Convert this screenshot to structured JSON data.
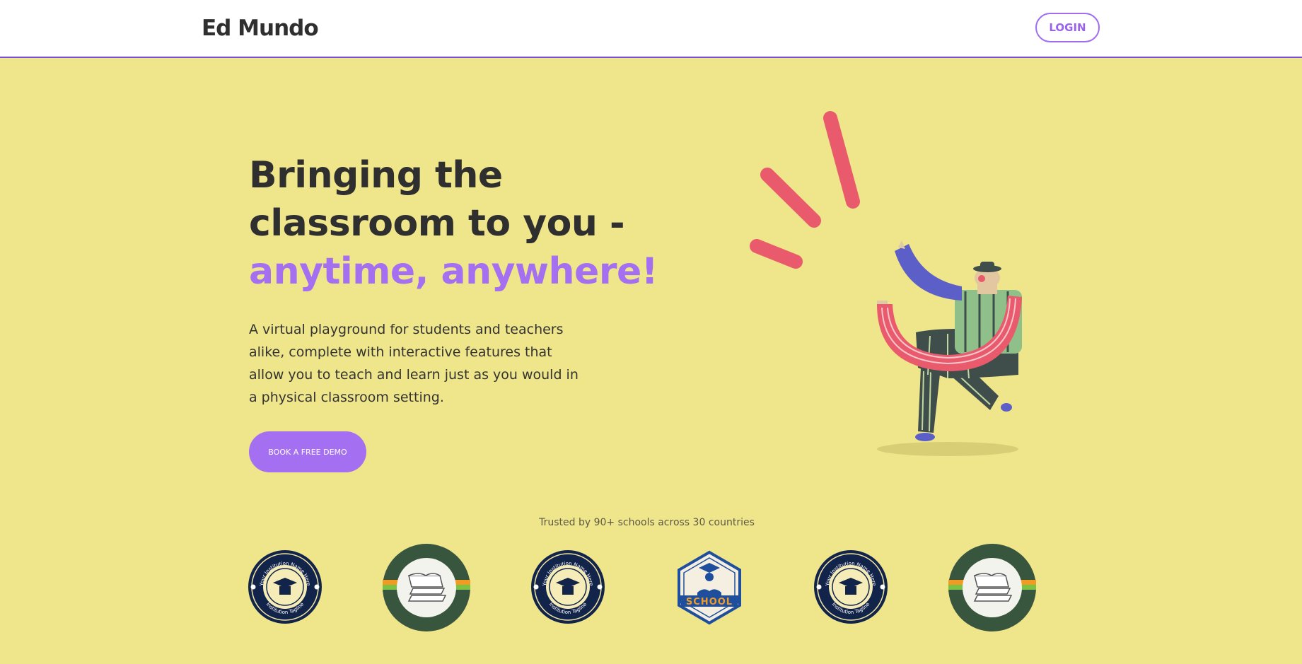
{
  "header": {
    "brand": "Ed Mundo",
    "login_label": "LOGIN"
  },
  "hero": {
    "title_line1": "Bringing the",
    "title_line2": "classroom to you -",
    "title_accent": "anytime, anywhere!",
    "subtitle": "A virtual playground for students and teachers alike, complete with interactive features that allow you to teach and learn just as you would in a physical classroom setting.",
    "cta_label": "BOOK A FREE DEMO"
  },
  "trusted": {
    "text": "Trusted by 90+ schools across 30 countries",
    "logos": [
      {
        "type": "institution-seal",
        "text_top": "Your Institution Name Here",
        "text_bottom": "Institution Tagline"
      },
      {
        "type": "green-book-seal"
      },
      {
        "type": "institution-seal",
        "text_top": "Your Institution Name Here",
        "text_bottom": "Institution Tagline"
      },
      {
        "type": "school-hexagon",
        "text": "SCHOOL"
      },
      {
        "type": "institution-seal",
        "text_top": "Your Institution Name Here",
        "text_bottom": "Institution Tagline"
      },
      {
        "type": "green-book-seal"
      }
    ]
  },
  "colors": {
    "background": "#efe58a",
    "accent": "#a46ff0",
    "text": "#2f2f2f"
  }
}
